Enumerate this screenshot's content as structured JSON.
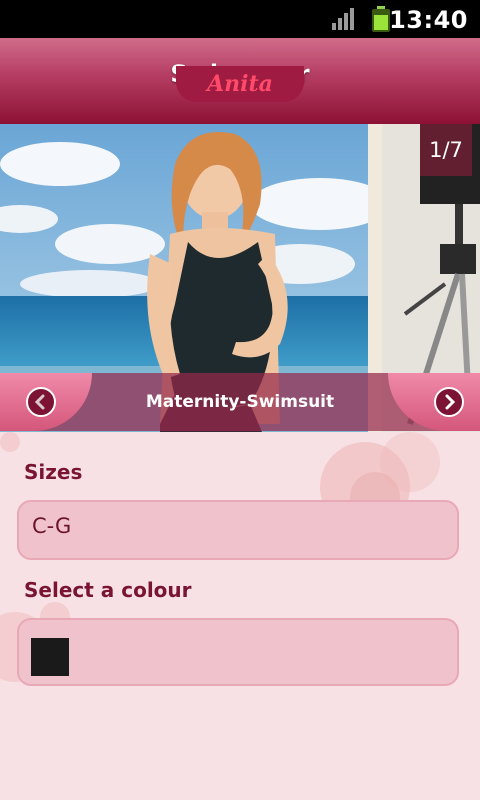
{
  "status_bar": {
    "time": "13:40",
    "signal_icon": "signal-icon",
    "battery_icon": "battery-icon"
  },
  "header": {
    "title": "Swimwear",
    "logo_text": "Anita"
  },
  "gallery": {
    "counter": "1/7",
    "caption": "Maternity-Swimsuit",
    "prev_icon": "chevron-left-icon",
    "next_icon": "chevron-right-icon"
  },
  "sizes": {
    "label": "Sizes",
    "value": "C-G"
  },
  "colour": {
    "label": "Select a colour",
    "selected_color": "#1a1a1a"
  },
  "colors": {
    "header_dark": "#8c1134",
    "accent": "#7a1531",
    "field_bg": "#f0c3cc"
  }
}
